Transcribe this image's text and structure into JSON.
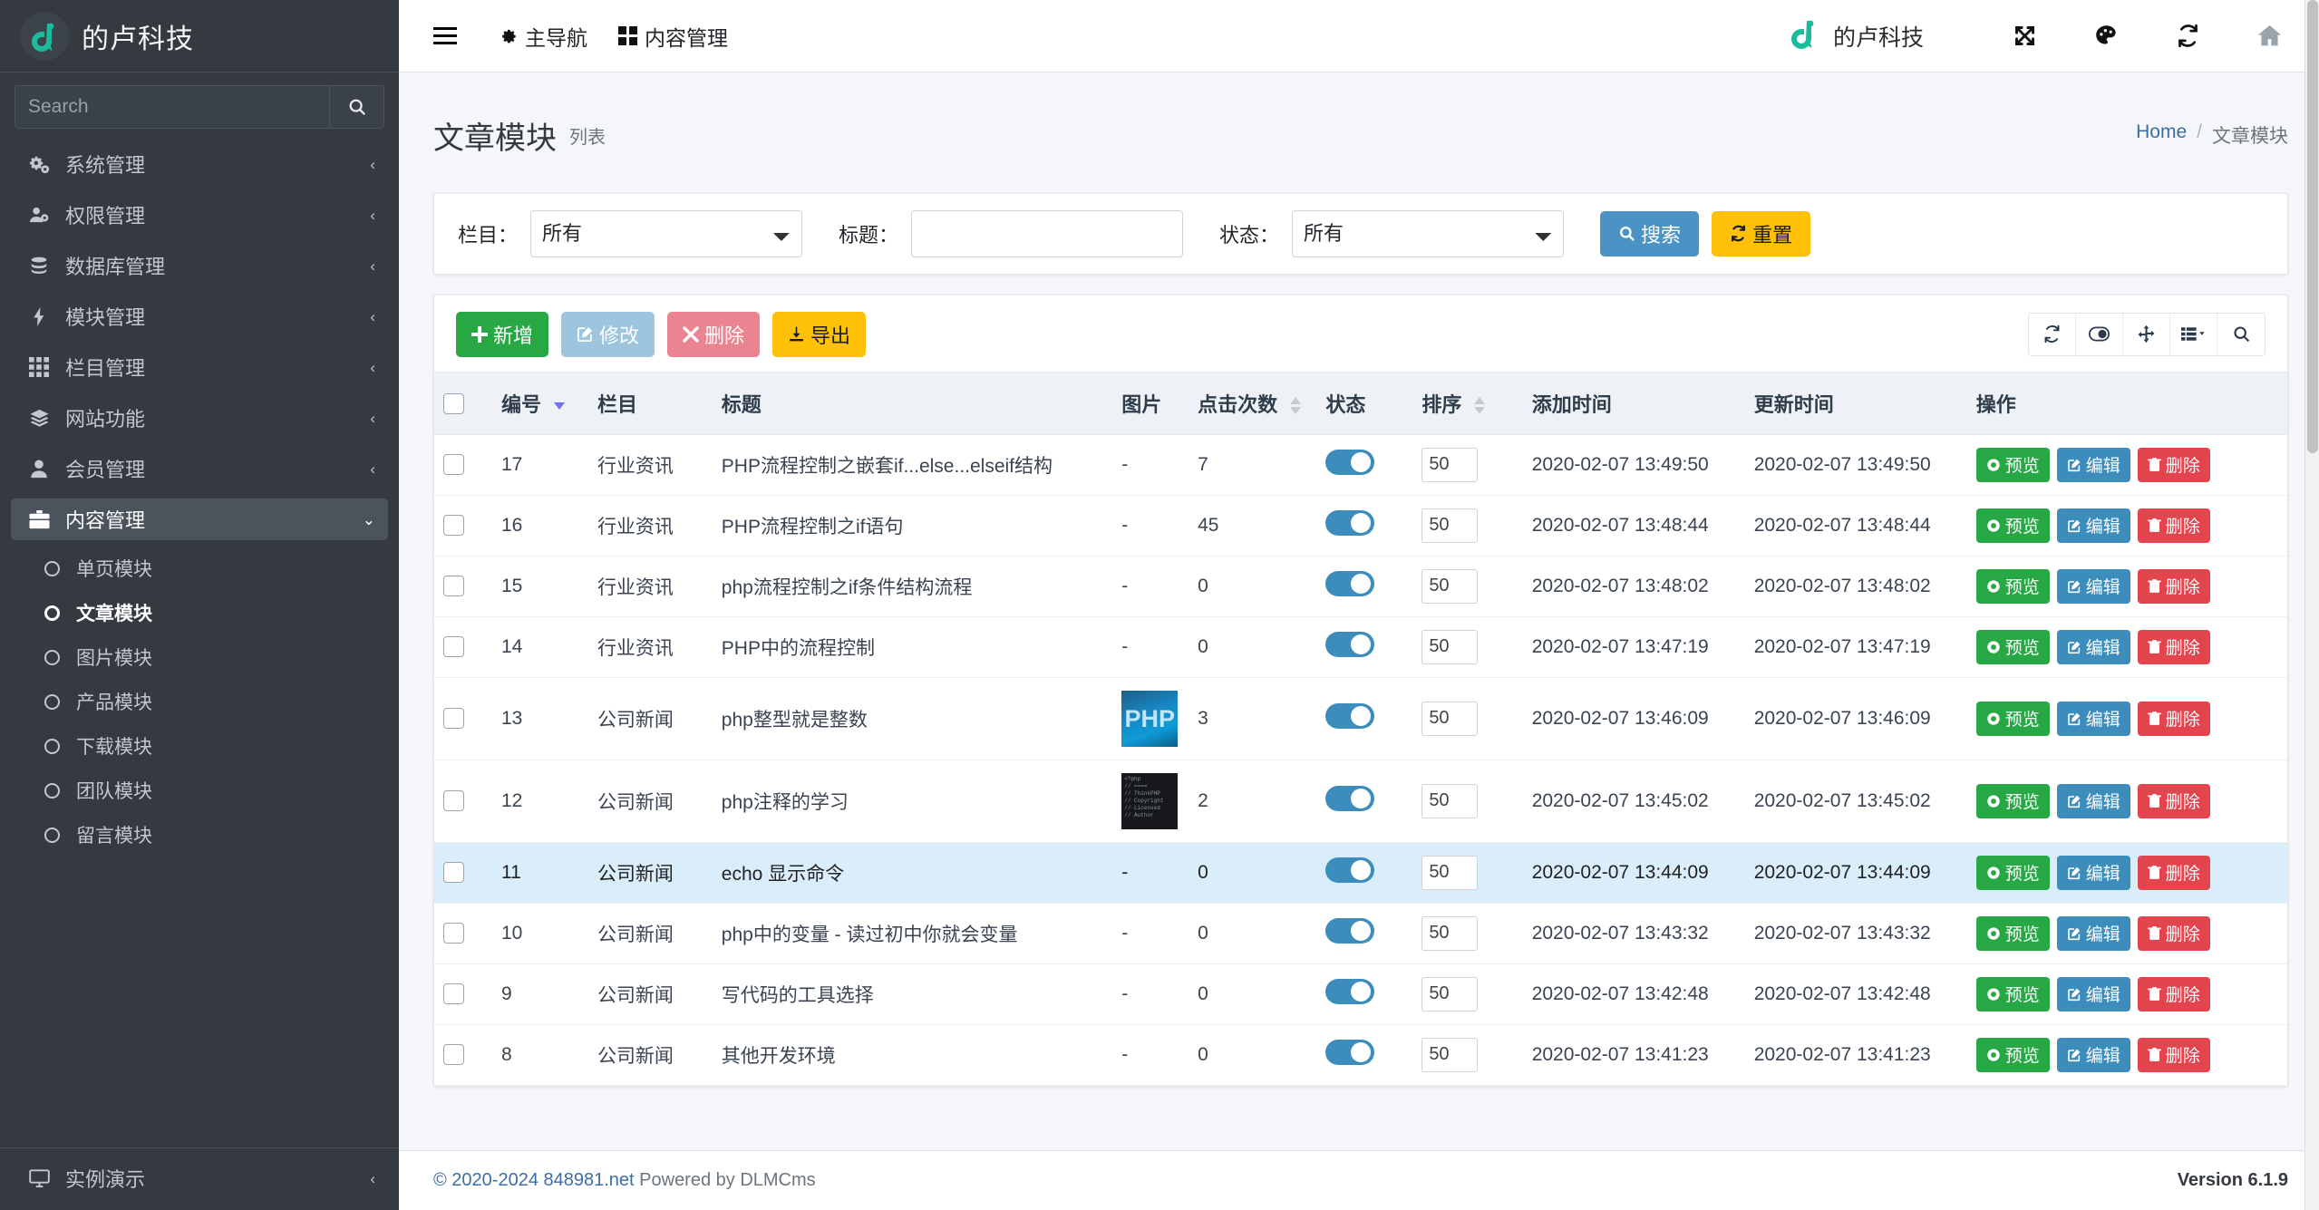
{
  "sidebar": {
    "brand": {
      "name": "的卢科技",
      "logo_icon": "dl-logo-icon"
    },
    "search": {
      "placeholder": "Search",
      "value": "",
      "icon": "search-icon"
    },
    "items": [
      {
        "label": "系统管理",
        "icon": "gears-icon",
        "arrow": "‹"
      },
      {
        "label": "权限管理",
        "icon": "user-gear-icon",
        "arrow": "‹"
      },
      {
        "label": "数据库管理",
        "icon": "database-icon",
        "arrow": "‹"
      },
      {
        "label": "模块管理",
        "icon": "bolt-icon",
        "arrow": "‹"
      },
      {
        "label": "栏目管理",
        "icon": "grid-icon",
        "arrow": "‹"
      },
      {
        "label": "网站功能",
        "icon": "layers-icon",
        "arrow": "‹"
      },
      {
        "label": "会员管理",
        "icon": "user-icon",
        "arrow": "‹"
      },
      {
        "label": "内容管理",
        "icon": "briefcase-icon",
        "arrow": "⌄"
      }
    ],
    "submenu": [
      {
        "label": "单页模块",
        "icon": "circle-icon"
      },
      {
        "label": "文章模块",
        "icon": "circle-icon"
      },
      {
        "label": "图片模块",
        "icon": "circle-icon"
      },
      {
        "label": "产品模块",
        "icon": "circle-icon"
      },
      {
        "label": "下载模块",
        "icon": "circle-icon"
      },
      {
        "label": "团队模块",
        "icon": "circle-icon"
      },
      {
        "label": "留言模块",
        "icon": "circle-icon"
      }
    ],
    "bottom_item": {
      "label": "实例演示",
      "icon": "desktop-icon",
      "arrow": "‹"
    }
  },
  "topbar": {
    "menu_toggle_icon": "hamburger-icon",
    "links": [
      {
        "label": "主导航",
        "icon": "gear-icon"
      },
      {
        "label": "内容管理",
        "icon": "grid-squares-icon"
      }
    ],
    "brand_name": "的卢科技",
    "brand_logo_icon": "dl-logo-icon",
    "icons": [
      {
        "name": "fullscreen-icon"
      },
      {
        "name": "palette-icon"
      },
      {
        "name": "refresh-icon"
      },
      {
        "name": "home-icon"
      }
    ]
  },
  "page": {
    "title": "文章模块",
    "subtitle": "列表",
    "breadcrumb": {
      "home": "Home",
      "sep": "/",
      "current": "文章模块"
    }
  },
  "filters": {
    "category": {
      "label": "栏目：",
      "value": "所有",
      "options": [
        "所有"
      ]
    },
    "title": {
      "label": "标题：",
      "value": "",
      "placeholder": ""
    },
    "status": {
      "label": "状态：",
      "value": "所有",
      "options": [
        "所有"
      ]
    },
    "search_button": {
      "label": "搜索",
      "icon": "search-icon"
    },
    "reset_button": {
      "label": "重置",
      "icon": "refresh-icon"
    }
  },
  "toolbar": {
    "buttons": [
      {
        "label": "新增",
        "icon": "plus-icon"
      },
      {
        "label": "修改",
        "icon": "pencil-square-icon"
      },
      {
        "label": "删除",
        "icon": "times-icon"
      },
      {
        "label": "导出",
        "icon": "download-icon"
      }
    ],
    "right_icons": [
      {
        "name": "refresh-icon"
      },
      {
        "name": "toggle-columns-icon"
      },
      {
        "name": "move-icon"
      },
      {
        "name": "column-list-icon"
      },
      {
        "name": "search-icon"
      }
    ]
  },
  "table": {
    "columns": [
      {
        "label": "",
        "key": "check"
      },
      {
        "label": "编号",
        "key": "id",
        "sortable": true,
        "sorted": "desc"
      },
      {
        "label": "栏目",
        "key": "category"
      },
      {
        "label": "标题",
        "key": "title"
      },
      {
        "label": "图片",
        "key": "image"
      },
      {
        "label": "点击次数",
        "key": "hits",
        "sortable": true
      },
      {
        "label": "状态",
        "key": "status"
      },
      {
        "label": "排序",
        "key": "order",
        "sortable": true
      },
      {
        "label": "添加时间",
        "key": "added"
      },
      {
        "label": "更新时间",
        "key": "updated"
      },
      {
        "label": "操作",
        "key": "ops"
      }
    ],
    "row_actions": [
      {
        "label": "预览",
        "icon": "eye-icon"
      },
      {
        "label": "编辑",
        "icon": "pencil-square-icon"
      },
      {
        "label": "删除",
        "icon": "trash-icon"
      }
    ],
    "rows": [
      {
        "id": "17",
        "category": "行业资讯",
        "title": "PHP流程控制之嵌套if...else...elseif结构",
        "image": "-",
        "image_type": "none",
        "hits": "7",
        "status": "on",
        "order": "50",
        "added": "2020-02-07 13:49:50",
        "updated": "2020-02-07 13:49:50",
        "selected": false
      },
      {
        "id": "16",
        "category": "行业资讯",
        "title": "PHP流程控制之if语句",
        "image": "-",
        "image_type": "none",
        "hits": "45",
        "status": "on",
        "order": "50",
        "added": "2020-02-07 13:48:44",
        "updated": "2020-02-07 13:48:44",
        "selected": false
      },
      {
        "id": "15",
        "category": "行业资讯",
        "title": "php流程控制之if条件结构流程",
        "image": "-",
        "image_type": "none",
        "hits": "0",
        "status": "on",
        "order": "50",
        "added": "2020-02-07 13:48:02",
        "updated": "2020-02-07 13:48:02",
        "selected": false
      },
      {
        "id": "14",
        "category": "行业资讯",
        "title": "PHP中的流程控制",
        "image": "-",
        "image_type": "none",
        "hits": "0",
        "status": "on",
        "order": "50",
        "added": "2020-02-07 13:47:19",
        "updated": "2020-02-07 13:47:19",
        "selected": false
      },
      {
        "id": "13",
        "category": "公司新闻",
        "title": "php整型就是整数",
        "image": "PHP",
        "image_type": "php",
        "hits": "3",
        "status": "on",
        "order": "50",
        "added": "2020-02-07 13:46:09",
        "updated": "2020-02-07 13:46:09",
        "selected": false
      },
      {
        "id": "12",
        "category": "公司新闻",
        "title": "php注释的学习",
        "image": "",
        "image_type": "code",
        "hits": "2",
        "status": "on",
        "order": "50",
        "added": "2020-02-07 13:45:02",
        "updated": "2020-02-07 13:45:02",
        "selected": false
      },
      {
        "id": "11",
        "category": "公司新闻",
        "title": "echo 显示命令",
        "image": "-",
        "image_type": "none",
        "hits": "0",
        "status": "on",
        "order": "50",
        "added": "2020-02-07 13:44:09",
        "updated": "2020-02-07 13:44:09",
        "selected": true
      },
      {
        "id": "10",
        "category": "公司新闻",
        "title": "php中的变量 - 读过初中你就会变量",
        "image": "-",
        "image_type": "none",
        "hits": "0",
        "status": "on",
        "order": "50",
        "added": "2020-02-07 13:43:32",
        "updated": "2020-02-07 13:43:32",
        "selected": false
      },
      {
        "id": "9",
        "category": "公司新闻",
        "title": "写代码的工具选择",
        "image": "-",
        "image_type": "none",
        "hits": "0",
        "status": "on",
        "order": "50",
        "added": "2020-02-07 13:42:48",
        "updated": "2020-02-07 13:42:48",
        "selected": false
      },
      {
        "id": "8",
        "category": "公司新闻",
        "title": "其他开发环境",
        "image": "-",
        "image_type": "none",
        "hits": "0",
        "status": "on",
        "order": "50",
        "added": "2020-02-07 13:41:23",
        "updated": "2020-02-07 13:41:23",
        "selected": false
      }
    ]
  },
  "footer": {
    "copyright": "© 2020-2024 848981.net",
    "powered": "Powered by DLMCms",
    "version_label": "Version",
    "version": "6.1.9"
  },
  "colors": {
    "sidebar_bg": "#343a40",
    "brand_green": "#1abc9c",
    "primary_blue": "#3c8dbc",
    "search_blue": "#4a93c4",
    "warning_yellow": "#fec107",
    "success_green": "#28a745",
    "danger_red": "#e3454f",
    "row_selected": "#d9edfb"
  }
}
